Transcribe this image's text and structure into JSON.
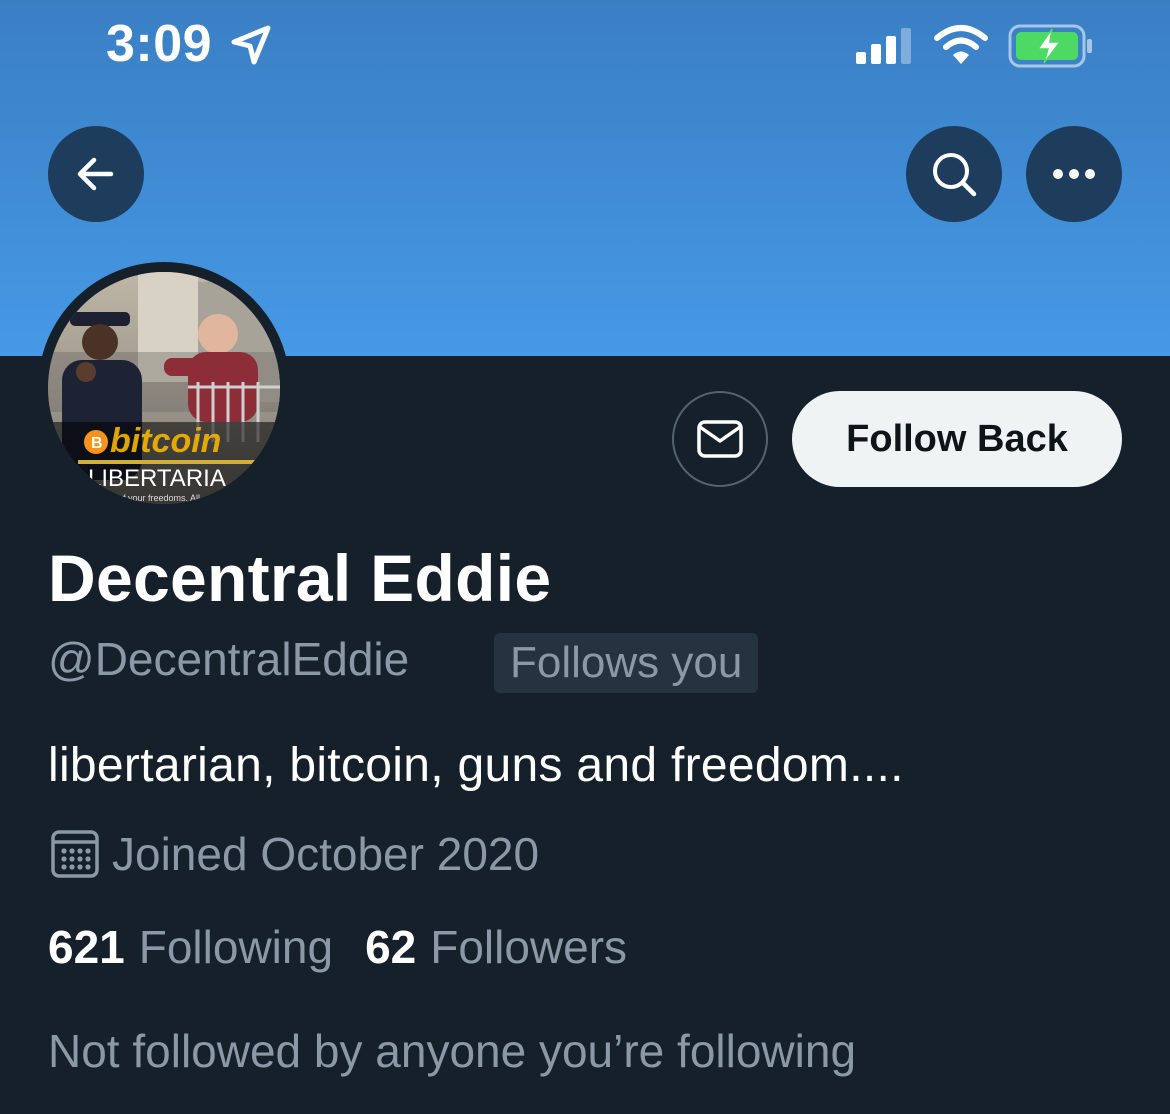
{
  "status_bar": {
    "time": "3:09",
    "icons": [
      "location-arrow-icon",
      "cellular-signal-icon",
      "wifi-icon",
      "battery-charging-icon"
    ],
    "battery_color": "#4cd964"
  },
  "header": {
    "back_icon": "arrow-left-icon",
    "search_icon": "search-icon",
    "more_icon": "more-horizontal-icon"
  },
  "avatar": {
    "text_bitcoin": "bitcoin",
    "text_libertarian": "LIBERTARIA",
    "text_small": "of your freedoms. All"
  },
  "actions": {
    "message_icon": "envelope-icon",
    "follow_label": "Follow Back"
  },
  "profile": {
    "display_name": "Decentral Eddie",
    "handle": "@DecentralEddie",
    "follows_you": "Follows you",
    "bio": "libertarian, bitcoin, guns and freedom....",
    "joined_icon": "calendar-icon",
    "joined": "Joined October 2020"
  },
  "stats": {
    "following_count": "621",
    "following_label": "Following",
    "followers_count": "62",
    "followers_label": "Followers"
  },
  "mutuals_text": "Not followed by anyone you’re following",
  "colors": {
    "background": "#15202b",
    "banner": "#4699e6",
    "secondary_text": "#8b98a5",
    "button_bg": "#eff3f4"
  }
}
